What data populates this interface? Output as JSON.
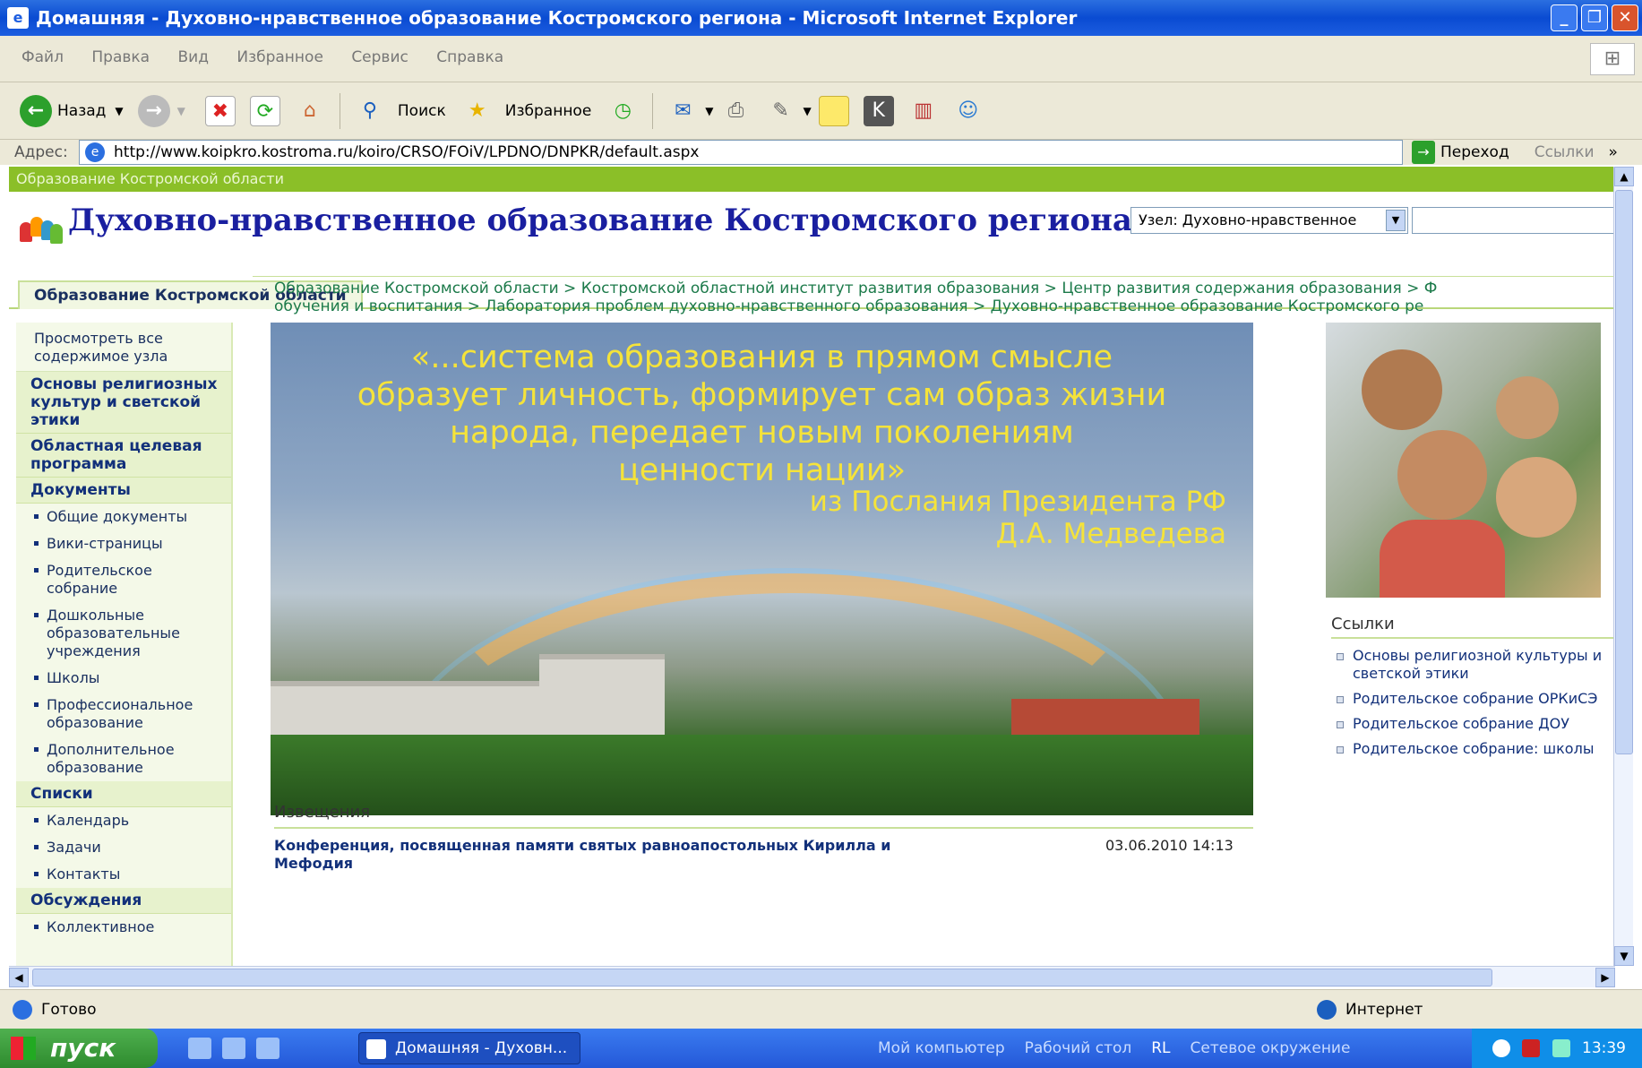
{
  "window": {
    "title": "Домашняя - Духовно-нравственное образование Костромского региона - Microsoft Internet Explorer"
  },
  "menu": [
    "Файл",
    "Правка",
    "Вид",
    "Избранное",
    "Сервис",
    "Справка"
  ],
  "toolbar": {
    "back": "Назад",
    "search": "Поиск",
    "favorites": "Избранное"
  },
  "address": {
    "label": "Адрес:",
    "url": "http://www.koipkro.kostroma.ru/koiro/CRSO/FOiV/LPDNO/DNPKR/default.aspx",
    "go": "Переход",
    "links": "Ссылки"
  },
  "page": {
    "topstrip": "Образование Костромской области",
    "title": "Духовно-нравственное образование Костромского региона",
    "site_select": "Узел: Духовно-нравственное",
    "tab": "Образование Костромской области",
    "breadcrumb_line1": "Образование Костромской области > Костромской областной институт развития образования > Центр развития содержания образования > Ф",
    "breadcrumb_line2": "обучения и воспитания > Лаборатория проблем духовно-нравственного образования > Духовно-нравственное образование Костромского ре",
    "quote": [
      "«...система образования в прямом смысле",
      "образует личность, формирует сам образ жизни",
      "народа, передает новым поколениям",
      "ценности нации»"
    ],
    "quote_attr": [
      "из Послания Президента РФ",
      "Д.А. Медведева"
    ],
    "links_title": "Ссылки",
    "links": [
      "Основы религиозной культуры и светской этики",
      "Родительское собрание ОРКиСЭ",
      "Родительское собрание ДОУ",
      "Родительское собрание: школы"
    ],
    "news_title": "Извещения",
    "news_item": "Конференция, посвященная памяти святых равноапостольных Кирилла и Мефодия",
    "news_date": "03.06.2010 14:13"
  },
  "leftnav": {
    "view_all": "Просмотреть все содержимое узла",
    "h1": "Основы религиозных культур и светской этики",
    "h2": "Областная целевая программа",
    "h3": "Документы",
    "docs": [
      "Общие документы",
      "Вики-страницы",
      "Родительское собрание",
      "Дошкольные образовательные учреждения",
      "Школы",
      "Профессиональное образование",
      "Дополнительное образование"
    ],
    "h4": "Списки",
    "lists": [
      "Календарь",
      "Задачи",
      "Контакты"
    ],
    "h5": "Обсуждения",
    "discussions": [
      "Коллективное"
    ]
  },
  "status": {
    "left": "Готово",
    "zone": "Интернет"
  },
  "taskbar": {
    "start": "пуск",
    "window": "Домашняя - Духовн...",
    "links": [
      "Мой компьютер",
      "Рабочий стол",
      "RL",
      "Сетевое окружение"
    ],
    "clock": "13:39"
  },
  "colors": {
    "accent_green": "#8bbf28",
    "title_blue": "#1a1fa0",
    "xp_blue": "#2458d8"
  }
}
